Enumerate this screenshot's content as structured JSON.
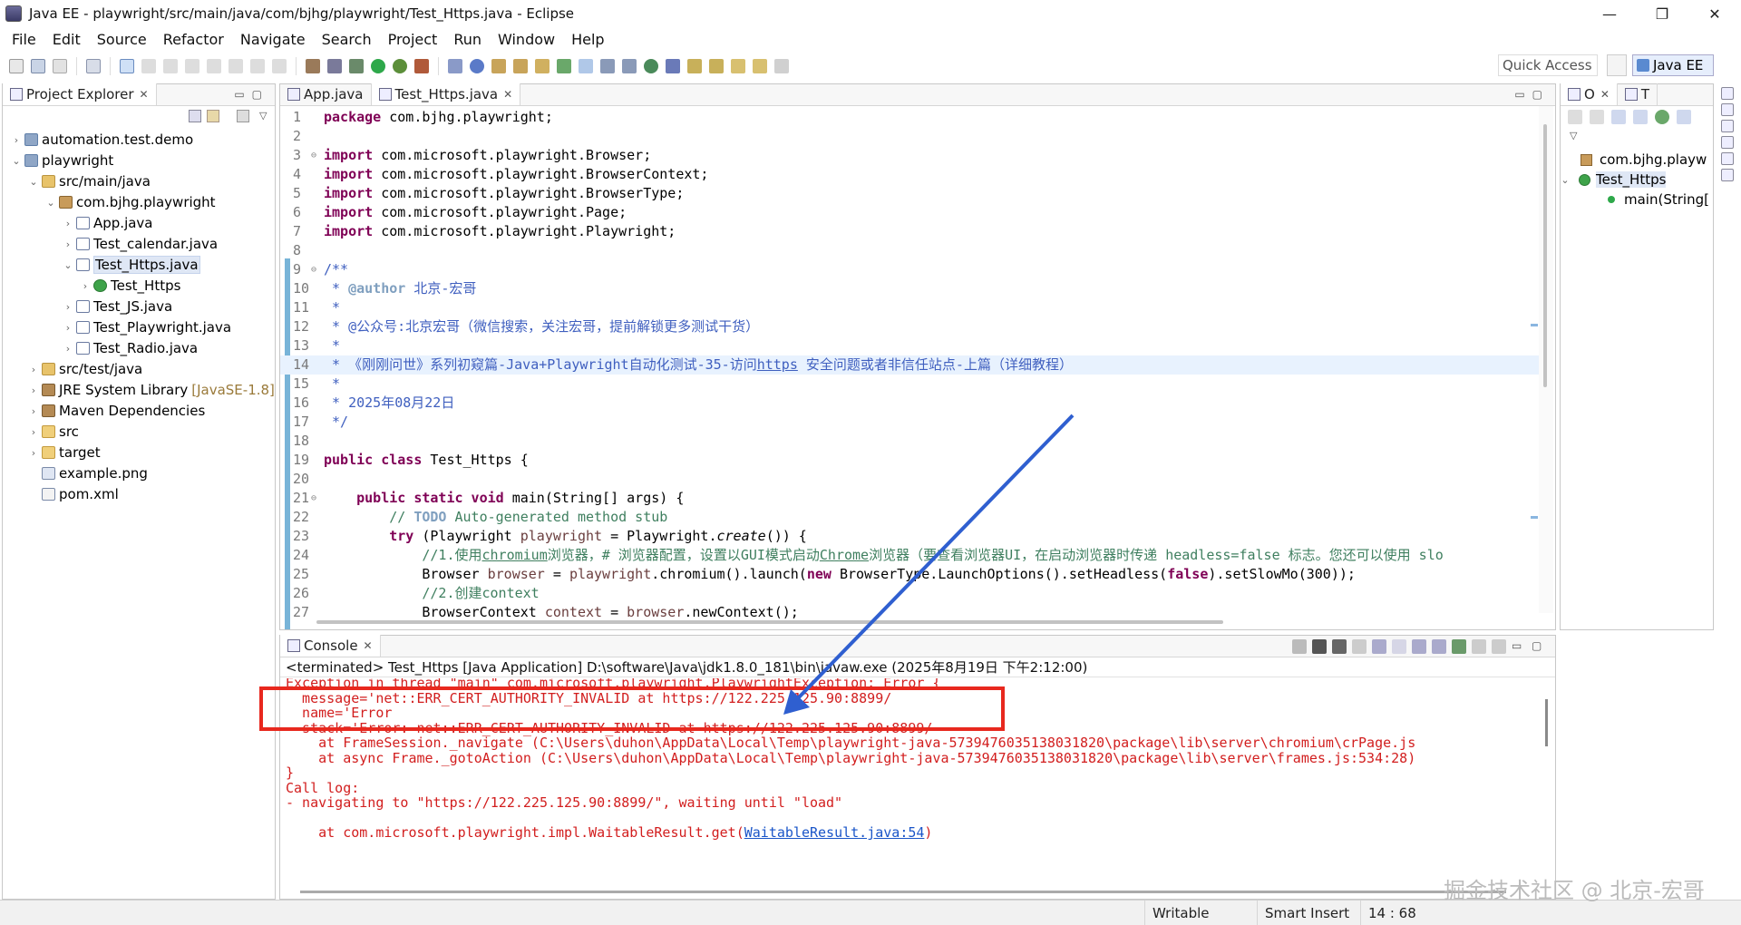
{
  "window": {
    "title": "Java EE - playwright/src/main/java/com/bjhg/playwright/Test_Https.java - Eclipse",
    "controls": [
      "—",
      "❐",
      "✕"
    ]
  },
  "menu": [
    "File",
    "Edit",
    "Source",
    "Refactor",
    "Navigate",
    "Search",
    "Project",
    "Run",
    "Window",
    "Help"
  ],
  "toolbar": {
    "quick_access": "Quick Access",
    "perspective": "Java EE"
  },
  "project_explorer": {
    "title": "Project Explorer",
    "close": "✕",
    "tree": [
      {
        "arrow": "›",
        "icon": "project",
        "label": "automation.test.demo",
        "decor": ""
      },
      {
        "arrow": "⌄",
        "icon": "project",
        "label": "playwright",
        "decor": ""
      },
      {
        "arrow": "⌄",
        "icon": "srcfolder",
        "label": "src/main/java",
        "decor": ""
      },
      {
        "arrow": "⌄",
        "icon": "package",
        "label": "com.bjhg.playwright",
        "decor": ""
      },
      {
        "arrow": "›",
        "icon": "javafile",
        "label": "App.java",
        "decor": ""
      },
      {
        "arrow": "›",
        "icon": "javafile",
        "label": "Test_calendar.java",
        "decor": ""
      },
      {
        "arrow": "⌄",
        "icon": "javafile",
        "label": "Test_Https.java",
        "decor": ""
      },
      {
        "arrow": "›",
        "icon": "classicon",
        "label": "Test_Https",
        "decor": ""
      },
      {
        "arrow": "›",
        "icon": "javafile",
        "label": "Test_JS.java",
        "decor": ""
      },
      {
        "arrow": "›",
        "icon": "javafile",
        "label": "Test_Playwright.java",
        "decor": ""
      },
      {
        "arrow": "›",
        "icon": "javafile",
        "label": "Test_Radio.java",
        "decor": ""
      },
      {
        "arrow": "›",
        "icon": "srcfolder",
        "label": "src/test/java",
        "decor": ""
      },
      {
        "arrow": "›",
        "icon": "library",
        "label": "JRE System Library",
        "decor": "[JavaSE-1.8]"
      },
      {
        "arrow": "›",
        "icon": "library",
        "label": "Maven Dependencies",
        "decor": ""
      },
      {
        "arrow": "›",
        "icon": "folder",
        "label": "src",
        "decor": ""
      },
      {
        "arrow": "›",
        "icon": "folder",
        "label": "target",
        "decor": ""
      },
      {
        "arrow": "",
        "icon": "png",
        "label": "example.png",
        "decor": ""
      },
      {
        "arrow": "",
        "icon": "xml",
        "label": "pom.xml",
        "decor": ""
      }
    ]
  },
  "editor": {
    "tabs": [
      {
        "label": "App.java",
        "active": false
      },
      {
        "label": "Test_Https.java",
        "active": true
      }
    ],
    "close": "✕",
    "lines": [
      {
        "n": "1",
        "fold": "",
        "t": "<span class=\"kw\">package</span> com.bjhg.playwright;"
      },
      {
        "n": "2",
        "fold": "",
        "t": ""
      },
      {
        "n": "3",
        "fold": "⊖",
        "t": "<span class=\"kw\">import</span> com.microsoft.playwright.Browser;"
      },
      {
        "n": "4",
        "fold": "",
        "t": "<span class=\"kw\">import</span> com.microsoft.playwright.BrowserContext;"
      },
      {
        "n": "5",
        "fold": "",
        "t": "<span class=\"kw\">import</span> com.microsoft.playwright.BrowserType;"
      },
      {
        "n": "6",
        "fold": "",
        "t": "<span class=\"kw\">import</span> com.microsoft.playwright.Page;"
      },
      {
        "n": "7",
        "fold": "",
        "t": "<span class=\"kw\">import</span> com.microsoft.playwright.Playwright;"
      },
      {
        "n": "8",
        "fold": "",
        "t": ""
      },
      {
        "n": "9",
        "fold": "⊖",
        "t": "<span class=\"jd\">/**</span>"
      },
      {
        "n": "10",
        "fold": "",
        "t": "<span class=\"jd\"> * <span class=\"tag\">@author</span> 北京-宏哥</span>"
      },
      {
        "n": "11",
        "fold": "",
        "t": "<span class=\"jd\"> *</span>"
      },
      {
        "n": "12",
        "fold": "",
        "t": "<span class=\"jd\"> * @公众号:北京宏哥（微信搜索，关注宏哥，提前解锁更多测试干货）</span>"
      },
      {
        "n": "13",
        "fold": "",
        "t": "<span class=\"jd\"> *</span>"
      },
      {
        "n": "14",
        "fold": "",
        "t": "<span class=\"jd\"> * 《刚刚问世》系列初窥篇-Java+Playwright自动化测试-35-访问<span class=\"ul\">https</span> 安全问题或者非信任站点-上篇（详细教程）</span>",
        "hl": true
      },
      {
        "n": "15",
        "fold": "",
        "t": "<span class=\"jd\"> *</span>"
      },
      {
        "n": "16",
        "fold": "",
        "t": "<span class=\"jd\"> * 2025年08月22日</span>"
      },
      {
        "n": "17",
        "fold": "",
        "t": "<span class=\"jd\"> */</span>"
      },
      {
        "n": "18",
        "fold": "",
        "t": ""
      },
      {
        "n": "19",
        "fold": "",
        "t": "<span class=\"kw\">public class</span> Test_Https {"
      },
      {
        "n": "20",
        "fold": "",
        "t": ""
      },
      {
        "n": "21",
        "fold": "⊖",
        "t": "    <span class=\"kw\">public static void</span> main(String[] args) {"
      },
      {
        "n": "22",
        "fold": "",
        "t": "        <span class=\"cm\">// <span class=\"tag\">TODO</span> Auto-generated method stub</span>"
      },
      {
        "n": "23",
        "fold": "",
        "t": "        <span class=\"kw\">try</span> (Playwright <span class=\"fld\">playwright</span> = Playwright.<span class=\"it\">create</span>()) {"
      },
      {
        "n": "24",
        "fold": "",
        "t": "            <span class=\"cm\">//1.使用<span class=\"ul\">chromium</span>浏览器，# 浏览器配置，设置以GUI模式启动<span class=\"ul\">Chrome</span>浏览器（要查看浏览器UI，在启动浏览器时传递 headless=false 标志。您还可以使用 slo</span>"
      },
      {
        "n": "25",
        "fold": "",
        "t": "            Browser <span class=\"fld\">browser</span> = <span class=\"fld\">playwright</span>.chromium().launch(<span class=\"kw\">new</span> BrowserType.LaunchOptions().setHeadless(<span class=\"kw\">false</span>).setSlowMo(300));"
      },
      {
        "n": "26",
        "fold": "",
        "t": "            <span class=\"cm\">//2.创建context</span>"
      },
      {
        "n": "27",
        "fold": "",
        "t": "            BrowserContext <span class=\"fld\">context</span> = <span class=\"fld\">browser</span>.newContext();"
      }
    ]
  },
  "outline": {
    "tabs": [
      "O",
      "T"
    ],
    "rows": [
      {
        "icon": "package",
        "label": "com.bjhg.playw"
      },
      {
        "icon": "classicon",
        "label": "Test_Https"
      },
      {
        "icon": "method",
        "label": "main(String["
      }
    ]
  },
  "console": {
    "title": "Console",
    "status": "<terminated> Test_Https [Java Application] D:\\software\\Java\\jdk1.8.0_181\\bin\\javaw.exe (2025年8月19日 下午2:12:00)",
    "lines": [
      "Exception in thread \"main\" com.microsoft.playwright.PlaywrightException: Error {",
      "  message='net::ERR_CERT_AUTHORITY_INVALID at https://122.225.125.90:8899/",
      "  name='Error",
      "  stack='Error: net::ERR_CERT_AUTHORITY_INVALID at https://122.225.125.90:8899/",
      "    at FrameSession._navigate (C:\\Users\\duhon\\AppData\\Local\\Temp\\playwright-java-5739476035138031820\\package\\lib\\server\\chromium\\crPage.js",
      "    at async Frame._gotoAction (C:\\Users\\duhon\\AppData\\Local\\Temp\\playwright-java-5739476035138031820\\package\\lib\\server\\frames.js:534:28)",
      "}",
      "Call log:",
      "- navigating to \"https://122.225.125.90:8899/\", waiting until \"load\"",
      "",
      "    at com.microsoft.playwright.impl.WaitableResult.get(WaitableResult.java:54)"
    ]
  },
  "statusbar": {
    "writable": "Writable",
    "insert_mode": "Smart Insert",
    "position": "14 : 68"
  },
  "watermark": "掘金技术社区 @ 北京-宏哥",
  "colors": {
    "annotation_box": "#e8281e",
    "annotation_arrow": "#2f5fd0",
    "console_error": "#d21e1e",
    "keyword": "#7f0055"
  }
}
